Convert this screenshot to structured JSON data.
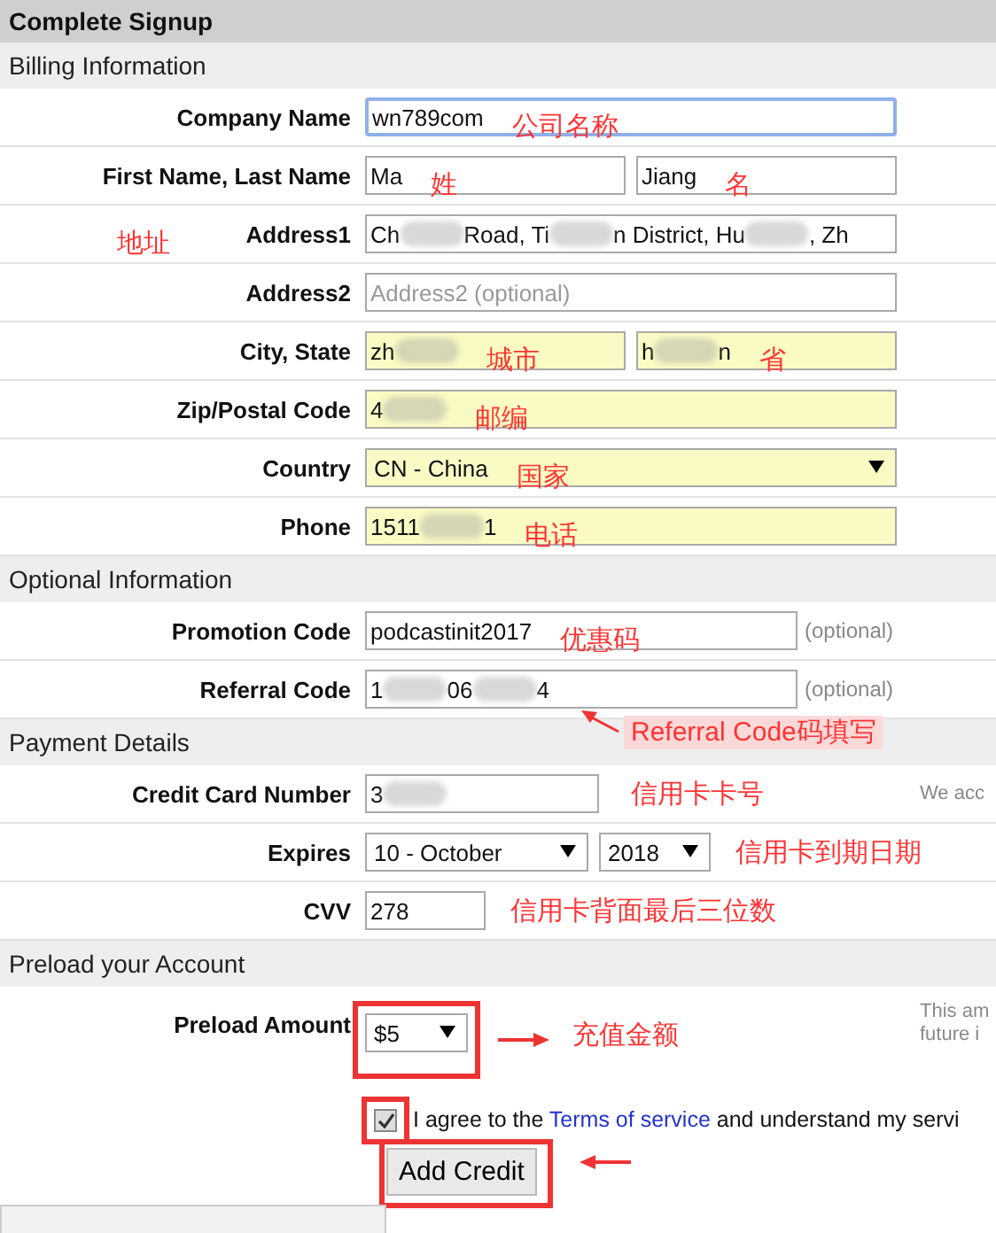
{
  "header": {
    "title": "Complete Signup"
  },
  "sections": [
    {
      "title": "Billing Information",
      "rows": [
        {
          "kind": "fields",
          "label": "Company Name",
          "fields": [
            {
              "kind": "text",
              "value": [
                {
                  "text": "wn789com"
                }
              ],
              "focused": true,
              "autofilled": false,
              "note": "公司名称"
            }
          ]
        },
        {
          "kind": "fields",
          "label": "First Name, Last Name",
          "fields": [
            {
              "kind": "text",
              "value": [
                {
                  "text": "Ma"
                }
              ],
              "focused": false,
              "autofilled": false,
              "note": "姓"
            },
            {
              "kind": "text",
              "value": [
                {
                  "text": "Jiang"
                }
              ],
              "focused": false,
              "autofilled": false,
              "note": "名"
            }
          ]
        },
        {
          "kind": "fields",
          "label": "Address1",
          "side_note": "地址",
          "fields": [
            {
              "kind": "text",
              "value": [
                {
                  "text": "Ch"
                },
                {
                  "kind": "redacted"
                },
                {
                  "text": "Road, Ti"
                },
                {
                  "kind": "redacted"
                },
                {
                  "text": "n District, Hu"
                },
                {
                  "kind": "redacted"
                },
                {
                  "text": ", Zh"
                }
              ],
              "focused": false,
              "autofilled": false
            }
          ]
        },
        {
          "kind": "fields",
          "label": "Address2",
          "fields": [
            {
              "kind": "text",
              "placeholder": "Address2 (optional)",
              "focused": false,
              "autofilled": false
            }
          ]
        },
        {
          "kind": "fields",
          "label": "City, State",
          "fields": [
            {
              "kind": "text",
              "value": [
                {
                  "text": "zh"
                },
                {
                  "kind": "redacted"
                }
              ],
              "focused": false,
              "autofilled": true,
              "note": "城市"
            },
            {
              "kind": "text",
              "value": [
                {
                  "text": "h"
                },
                {
                  "kind": "redacted"
                },
                {
                  "text": "n"
                }
              ],
              "focused": false,
              "autofilled": true,
              "note": "省"
            }
          ]
        },
        {
          "kind": "fields",
          "label": "Zip/Postal Code",
          "fields": [
            {
              "kind": "text",
              "value": [
                {
                  "text": "4"
                },
                {
                  "kind": "redacted"
                }
              ],
              "focused": false,
              "autofilled": true,
              "note": "邮编"
            }
          ]
        },
        {
          "kind": "fields",
          "label": "Country",
          "fields": [
            {
              "kind": "select",
              "value": [
                {
                  "text": "CN - China"
                }
              ],
              "focused": false,
              "autofilled": true,
              "note": "国家"
            }
          ]
        },
        {
          "kind": "fields",
          "label": "Phone",
          "fields": [
            {
              "kind": "text",
              "value": [
                {
                  "text": "1511"
                },
                {
                  "kind": "redacted"
                },
                {
                  "text": "1"
                }
              ],
              "focused": false,
              "autofilled": true,
              "note": "电话"
            }
          ]
        }
      ]
    },
    {
      "title": "Optional Information",
      "rows": [
        {
          "kind": "optional",
          "label": "Promotion Code",
          "hint": "(optional)",
          "fields": [
            {
              "kind": "text",
              "value": [
                {
                  "text": "podcastinit2017"
                }
              ],
              "focused": false,
              "autofilled": false,
              "note": "优惠码"
            }
          ]
        },
        {
          "kind": "optional",
          "label": "Referral Code",
          "hint": "(optional)",
          "callout": "Referral Code码填写",
          "fields": [
            {
              "kind": "text",
              "value": [
                {
                  "text": "1"
                },
                {
                  "kind": "redacted"
                },
                {
                  "text": "06"
                },
                {
                  "kind": "redacted"
                },
                {
                  "text": "4"
                }
              ],
              "focused": false,
              "autofilled": false
            }
          ]
        }
      ]
    },
    {
      "title": "Payment Details",
      "rows": [
        {
          "kind": "card",
          "label": "Credit Card Number",
          "note": "信用卡卡号",
          "aside": [
            "We acc"
          ],
          "fields": [
            {
              "kind": "text",
              "value": [
                {
                  "text": "3"
                },
                {
                  "kind": "redacted"
                }
              ],
              "focused": false,
              "autofilled": false
            }
          ]
        },
        {
          "kind": "expiry",
          "label": "Expires",
          "note": "信用卡到期日期",
          "fields": [
            {
              "kind": "select",
              "value": [
                {
                  "text": "10 - October"
                }
              ],
              "focused": false,
              "autofilled": false
            },
            {
              "kind": "select",
              "value": [
                {
                  "text": "2018"
                }
              ],
              "focused": false,
              "autofilled": false
            }
          ]
        },
        {
          "kind": "cvv",
          "label": "CVV",
          "note": "信用卡背面最后三位数",
          "fields": [
            {
              "kind": "text",
              "value": [
                {
                  "text": "278"
                }
              ],
              "focused": false,
              "autofilled": false
            }
          ]
        }
      ]
    },
    {
      "title": "Preload your Account",
      "rows": [
        {
          "kind": "amount",
          "label": "Preload Amount",
          "note": "充值金额",
          "aside": [
            "This am",
            "future i"
          ],
          "fields": [
            {
              "kind": "select",
              "value": [
                {
                  "text": "$5"
                }
              ],
              "focused": false,
              "autofilled": false,
              "highlighted": true
            }
          ]
        }
      ]
    }
  ],
  "agreement": {
    "checked": true,
    "highlighted": true,
    "before": "I agree to the ",
    "link": "Terms of service",
    "after": " and understand my servi"
  },
  "submit": {
    "label": "Add Credit",
    "highlighted": true
  }
}
